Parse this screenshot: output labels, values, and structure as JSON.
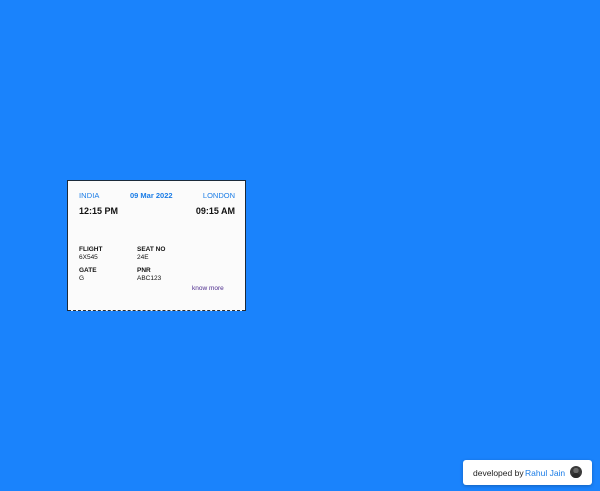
{
  "ticket": {
    "origin": "INDIA",
    "date": "09 Mar 2022",
    "destination": "LONDON",
    "departure_time": "12:15 PM",
    "arrival_time": "09:15 AM",
    "flight_label": "FLIGHT",
    "flight_value": "6X545",
    "seat_label": "SEAT NO",
    "seat_value": "24E",
    "gate_label": "GATE",
    "gate_value": "G",
    "pnr_label": "PNR",
    "pnr_value": "ABC123",
    "know_more": "know more"
  },
  "credit": {
    "prefix": "developed by",
    "author": "Rahul Jain",
    "avatar_icon": "user-avatar"
  },
  "colors": {
    "background": "#1a83fc",
    "accent": "#1a7ce6",
    "link": "#4b2a8c"
  }
}
